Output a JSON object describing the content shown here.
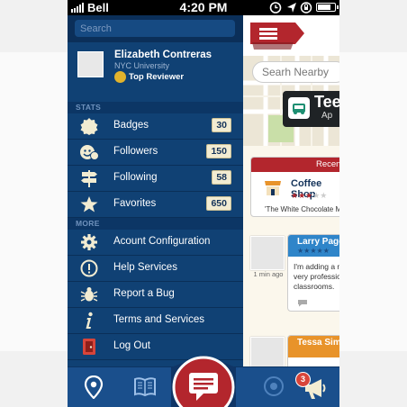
{
  "status_bar": {
    "carrier": "Bell",
    "time": "4:20 PM"
  },
  "sidebar": {
    "search": {
      "placeholder": "Search"
    },
    "profile": {
      "name": "Elizabeth Contreras",
      "university": "NYC University",
      "rank": "Top Reviewer"
    },
    "stats": {
      "title": "STATS",
      "items": [
        {
          "label": "Badges",
          "count": "30",
          "icon": "badge-icon"
        },
        {
          "label": "Followers",
          "count": "150",
          "icon": "followers-icon"
        },
        {
          "label": "Following",
          "count": "58",
          "icon": "signpost-icon"
        },
        {
          "label": "Favorites",
          "count": "650",
          "icon": "star-icon"
        }
      ]
    },
    "more": {
      "title": "MORE",
      "items": [
        {
          "label": "Acount Configuration",
          "icon": "gear-icon"
        },
        {
          "label": "Help Services",
          "icon": "help-icon"
        },
        {
          "label": "Report a Bug",
          "icon": "bug-icon"
        },
        {
          "label": "Terms and Services",
          "icon": "info-icon"
        },
        {
          "label": "Log Out",
          "icon": "logout-icon"
        }
      ]
    }
  },
  "main": {
    "search_placeholder": "Searh Nearby",
    "map_callout": {
      "title": "Tee",
      "subtitle": "Ap"
    },
    "recent": {
      "header": "Recent",
      "place": "Coffee Shop",
      "rating": 3,
      "quote": "'The White Chocolate M"
    },
    "reviews": [
      {
        "name": "Larry Page",
        "time_ago": "1 min ago",
        "rating": 5,
        "text_lines": [
          "I'm adding a n",
          "very professio",
          "classrooms."
        ],
        "header_color": "#2f85c9"
      },
      {
        "name": "Tessa Simo",
        "time_ago": "",
        "rating": 5,
        "text_lines": [],
        "header_color": "#e8932a"
      }
    ]
  },
  "tabbar": {
    "items": [
      "location-pin-icon",
      "book-icon",
      "compose-icon",
      "target-icon",
      "megaphone-icon"
    ],
    "notification_count": "3"
  },
  "colors": {
    "sidebar_bg": "#104174",
    "accent_red": "#b3262d",
    "tabbar_bg": "#1a4f8c",
    "count_bg": "#f2ecd2"
  }
}
